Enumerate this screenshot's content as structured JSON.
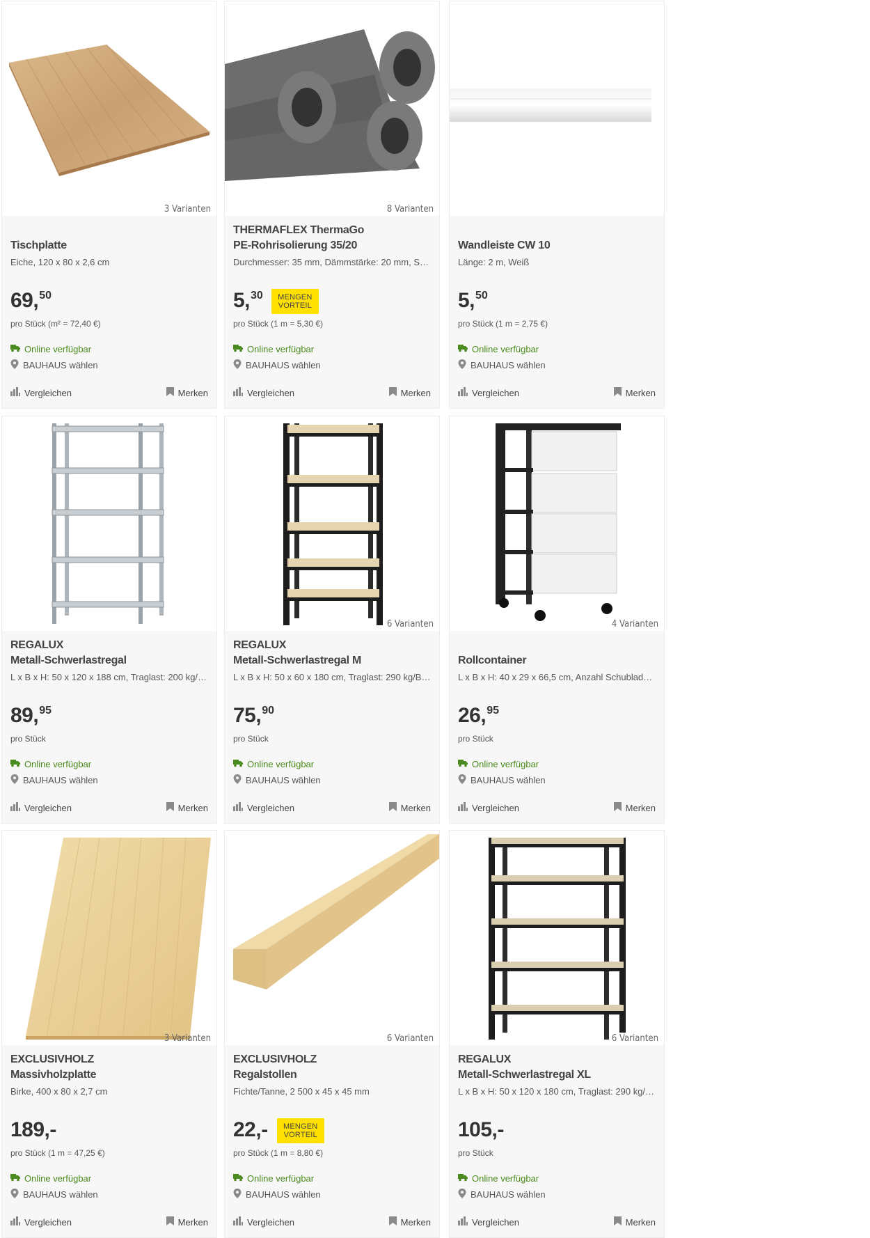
{
  "products": [
    {
      "brand": "",
      "name": "Tischplatte",
      "description": "Eiche, 120 x 80 x 2,6 cm",
      "variants": "3 Varianten",
      "price_main": "69,",
      "price_cents": "50",
      "badge": "",
      "unit": "pro Stück (m² = 72,40 €)",
      "availability": "Online verfügbar",
      "store": "BAUHAUS wählen",
      "compare": "Vergleichen",
      "save": "Merken",
      "image": "tabletop-oak"
    },
    {
      "brand": "THERMAFLEX ThermaGo",
      "name": "PE-Rohrisolierung 35/20",
      "description": "Durchmesser: 35 mm, Dämmstärke: 20 mm, Sel...",
      "variants": "8 Varianten",
      "price_main": "5,",
      "price_cents": "30",
      "badge": "MENGEN VORTEIL",
      "unit": "pro Stück (1 m = 5,30 €)",
      "availability": "Online verfügbar",
      "store": "BAUHAUS wählen",
      "compare": "Vergleichen",
      "save": "Merken",
      "image": "pipe-insulation"
    },
    {
      "brand": "",
      "name": "Wandleiste CW 10",
      "description": "Länge: 2 m, Weiß",
      "variants": "",
      "price_main": "5,",
      "price_cents": "50",
      "badge": "",
      "unit": "pro Stück (1 m = 2,75 €)",
      "availability": "Online verfügbar",
      "store": "BAUHAUS wählen",
      "compare": "Vergleichen",
      "save": "Merken",
      "image": "wall-molding"
    },
    {
      "brand": "REGALUX",
      "name": "Metall-Schwerlastregal",
      "description": "L x B x H: 50 x 120 x 188 cm, Traglast: 200 kg/B...",
      "variants": "",
      "price_main": "89,",
      "price_cents": "95",
      "badge": "",
      "unit": "pro Stück",
      "availability": "Online verfügbar",
      "store": "BAUHAUS wählen",
      "compare": "Vergleichen",
      "save": "Merken",
      "image": "shelf-galvanized"
    },
    {
      "brand": "REGALUX",
      "name": "Metall-Schwerlastregal M",
      "description": "L x B x H: 50 x 60 x 180 cm, Traglast: 290 kg/Bo...",
      "variants": "6 Varianten",
      "price_main": "75,",
      "price_cents": "90",
      "badge": "",
      "unit": "pro Stück",
      "availability": "Online verfügbar",
      "store": "BAUHAUS wählen",
      "compare": "Vergleichen",
      "save": "Merken",
      "image": "shelf-black-narrow"
    },
    {
      "brand": "",
      "name": "Rollcontainer",
      "description": "L x B x H: 40 x 29 x 66,5 cm, Anzahl Schublade...",
      "variants": "4 Varianten",
      "price_main": "26,",
      "price_cents": "95",
      "badge": "",
      "unit": "pro Stück",
      "availability": "Online verfügbar",
      "store": "BAUHAUS wählen",
      "compare": "Vergleichen",
      "save": "Merken",
      "image": "rolling-drawers"
    },
    {
      "brand": "EXCLUSIVHOLZ",
      "name": "Massivholzplatte",
      "description": "Birke, 400 x 80 x 2,7 cm",
      "variants": "3 Varianten",
      "price_main": "189,-",
      "price_cents": "",
      "badge": "",
      "unit": "pro Stück (1 m = 47,25 €)",
      "availability": "Online verfügbar",
      "store": "BAUHAUS wählen",
      "compare": "Vergleichen",
      "save": "Merken",
      "image": "birch-board"
    },
    {
      "brand": "EXCLUSIVHOLZ",
      "name": "Regalstollen",
      "description": "Fichte/Tanne, 2 500 x 45 x 45 mm",
      "variants": "6 Varianten",
      "price_main": "22,-",
      "price_cents": "",
      "badge": "MENGEN VORTEIL",
      "unit": "pro Stück (1 m = 8,80 €)",
      "availability": "Online verfügbar",
      "store": "BAUHAUS wählen",
      "compare": "Vergleichen",
      "save": "Merken",
      "image": "wood-beam"
    },
    {
      "brand": "REGALUX",
      "name": "Metall-Schwerlastregal XL",
      "description": "L x B x H: 50 x 120 x 180 cm, Traglast: 290 kg/B...",
      "variants": "6 Varianten",
      "price_main": "105,-",
      "price_cents": "",
      "badge": "",
      "unit": "pro Stück",
      "availability": "Online verfügbar",
      "store": "BAUHAUS wählen",
      "compare": "Vergleichen",
      "save": "Merken",
      "image": "shelf-black-wide"
    }
  ],
  "colors": {
    "available_green": "#4a8a1e",
    "badge_yellow": "#ffe000",
    "card_bg": "#f7f7f7"
  }
}
